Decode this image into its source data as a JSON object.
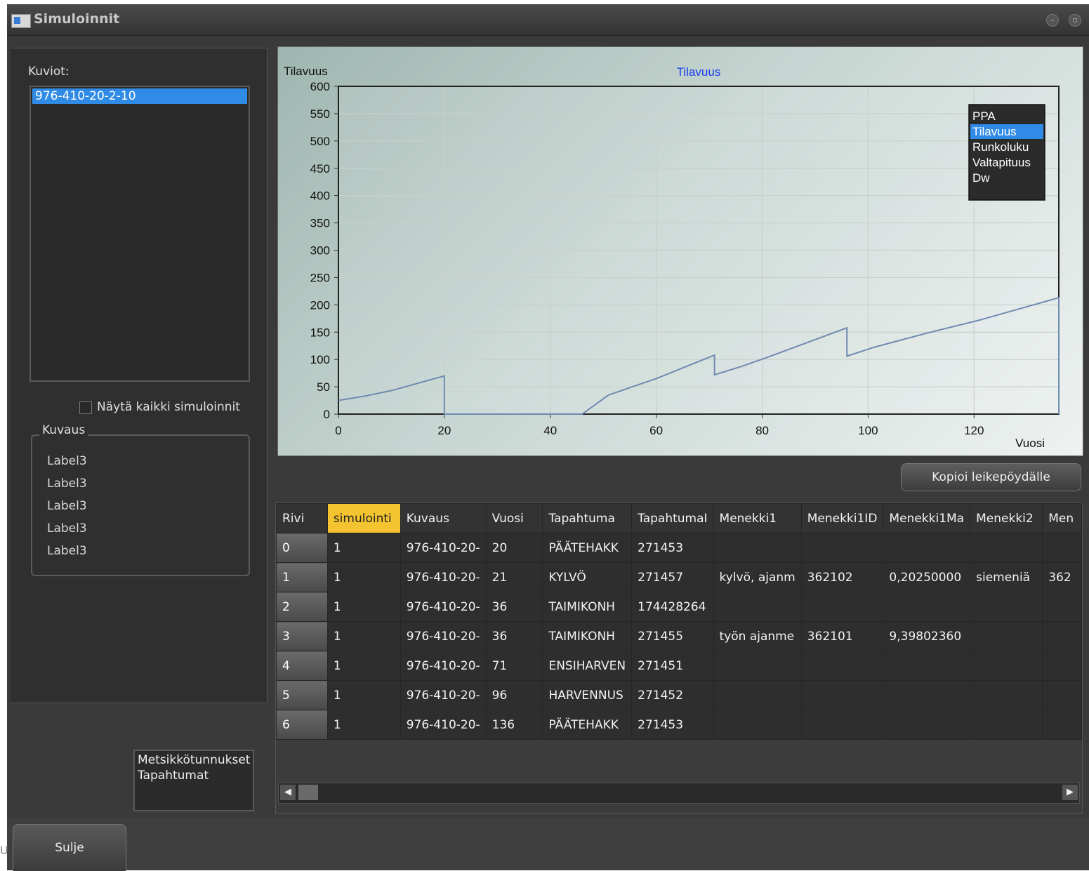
{
  "window": {
    "title": "Simuloinnit"
  },
  "left": {
    "kuviot_label": "Kuviot:",
    "kuviot_items": [
      "976-410-20-2-10"
    ],
    "show_all_label": "Näytä kaikki simuloinnit",
    "kuvaus_title": "Kuvaus",
    "kuvaus_labels": [
      "Label3",
      "Label3",
      "Label3",
      "Label3",
      "Label3"
    ],
    "info_lines": [
      "Metsikkötunnukset",
      "Tapahtumat"
    ]
  },
  "chart_data": {
    "type": "line",
    "title": "Tilavuus",
    "xlabel": "Vuosi",
    "ylabel": "Tilavuus",
    "xlim": [
      0,
      136
    ],
    "ylim": [
      0,
      600
    ],
    "xticks": [
      0,
      20,
      40,
      60,
      80,
      100,
      120
    ],
    "yticks": [
      0,
      50,
      100,
      150,
      200,
      250,
      300,
      350,
      400,
      450,
      500,
      550,
      600
    ],
    "grid": true,
    "legend_position": "top-right",
    "legend_items": [
      "PPA",
      "Tilavuus",
      "Runkoluku",
      "Valtapituus",
      "Dw"
    ],
    "legend_selected": "Tilavuus",
    "series": [
      {
        "name": "Tilavuus",
        "color": "#6f8ab0",
        "x": [
          0,
          5,
          10,
          20,
          20,
          30,
          40,
          46,
          51,
          60,
          71,
          71,
          76,
          81,
          96,
          96,
          101,
          111,
          121,
          136,
          136
        ],
        "y": [
          25,
          33,
          43,
          70,
          0,
          0,
          0,
          0,
          35,
          65,
          108,
          72,
          87,
          104,
          158,
          106,
          122,
          148,
          172,
          213,
          0
        ]
      }
    ]
  },
  "copy_button": "Kopioi leikepöydälle",
  "table": {
    "columns": [
      "Rivi",
      "simulointi",
      "Kuvaus",
      "Vuosi",
      "Tapahtuma",
      "TapahtumaI",
      "Menekki1",
      "Menekki1ID",
      "Menekki1Ma",
      "Menekki2",
      "Men"
    ],
    "selected_column": "simulointi",
    "rows": [
      [
        "0",
        "1",
        "976-410-20-",
        "20",
        "PÄÄTEHAKK",
        "271453",
        "",
        "",
        "",
        "",
        ""
      ],
      [
        "1",
        "1",
        "976-410-20-",
        "21",
        "KYLVÖ",
        "271457",
        "kylvö, ajanm",
        "362102",
        "0,20250000",
        "siemeniä",
        "362"
      ],
      [
        "2",
        "1",
        "976-410-20-",
        "36",
        "TAIMIKONH",
        "174428264",
        "",
        "",
        "",
        "",
        ""
      ],
      [
        "3",
        "1",
        "976-410-20-",
        "36",
        "TAIMIKONH",
        "271455",
        "työn ajanme",
        "362101",
        "9,39802360",
        "",
        ""
      ],
      [
        "4",
        "1",
        "976-410-20-",
        "71",
        "ENSIHARVEN",
        "271451",
        "",
        "",
        "",
        "",
        ""
      ],
      [
        "5",
        "1",
        "976-410-20-",
        "96",
        "HARVENNUS",
        "271452",
        "",
        "",
        "",
        "",
        ""
      ],
      [
        "6",
        "1",
        "976-410-20-",
        "136",
        "PÄÄTEHAKK",
        "271453",
        "",
        "",
        "",
        "",
        ""
      ]
    ]
  },
  "close_button": "Sulje",
  "edge_char": "U"
}
